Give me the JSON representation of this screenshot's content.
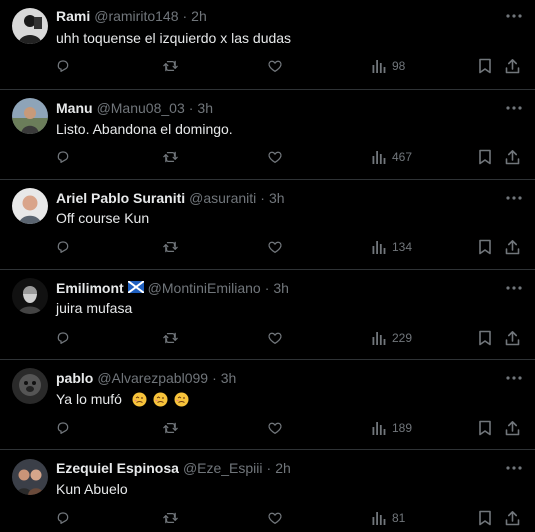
{
  "tweets": [
    {
      "name": "Rami",
      "handle": "@ramirito148",
      "sep": "·",
      "time": "2h",
      "text": "uhh toquense el izquierdo x las dudas",
      "views": "98"
    },
    {
      "name": "Manu",
      "handle": "@Manu08_03",
      "sep": "·",
      "time": "3h",
      "text": "Listo. Abandona el domingo.",
      "views": "467"
    },
    {
      "name": "Ariel Pablo Suraniti",
      "handle": "@asuraniti",
      "sep": "·",
      "time": "3h",
      "text": "Off course Kun",
      "views": "134"
    },
    {
      "name": "Emilimont",
      "flag": "scotland-flag",
      "handle": "@MontiniEmiliano",
      "sep": "·",
      "time": "3h",
      "text": "juira mufasa",
      "views": "229"
    },
    {
      "name": "pablo",
      "handle": "@Alvarezpabl099",
      "sep": "·",
      "time": "3h",
      "text": "Ya lo mufó",
      "emoji": [
        "woozy-face",
        "woozy-face",
        "woozy-face"
      ],
      "views": "189"
    },
    {
      "name": "Ezequiel Espinosa",
      "handle": "@Eze_Espiii",
      "sep": "·",
      "time": "2h",
      "text": "Kun Abuelo",
      "views": "81"
    }
  ],
  "icons": {
    "reply": "reply-icon",
    "retweet": "retweet-icon",
    "like": "like-icon",
    "views": "views-icon",
    "bookmark": "bookmark-icon",
    "share": "share-icon",
    "more": "more-icon"
  },
  "colors": {
    "background": "#000000",
    "text": "#e7e9ea",
    "muted": "#71767b",
    "divider": "#2f3336"
  }
}
